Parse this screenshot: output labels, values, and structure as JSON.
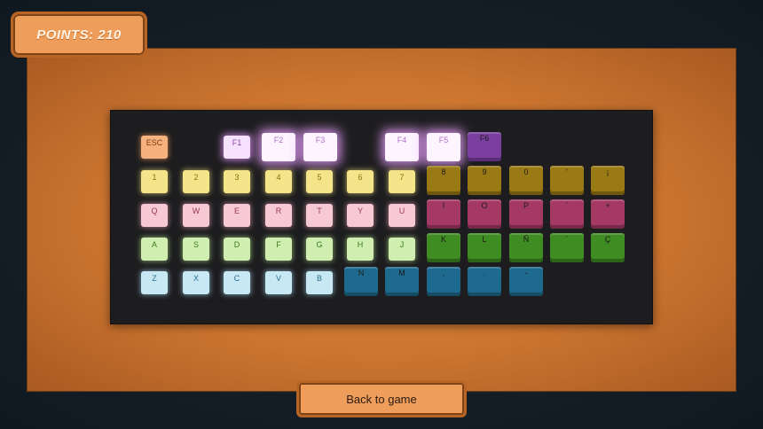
{
  "hud": {
    "points": "POINTS: 210"
  },
  "buttons": {
    "back": "Back to game"
  },
  "keys": {
    "esc": "ESC",
    "f1": "F1",
    "f2": "F2",
    "f3": "F3",
    "f4": "F4",
    "f5": "F5",
    "f6": "F6",
    "n1": "1",
    "n2": "2",
    "n3": "3",
    "n4": "4",
    "n5": "5",
    "n6": "6",
    "n7": "7",
    "n8": "8",
    "n9": "9",
    "n0": "0",
    "apos": "'",
    "iexcl": "¡",
    "q": "Q",
    "w": "W",
    "e": "E",
    "r": "R",
    "t": "T",
    "yk": "Y",
    "u": "U",
    "i": "I",
    "o": "O",
    "pk": "P",
    "grave": "`",
    "plus": "+",
    "a": "A",
    "s": "S",
    "d": "D",
    "f": "F",
    "gk": "G",
    "h": "H",
    "j": "J",
    "k": "K",
    "l": "L",
    "ntilde": "Ñ",
    "acute": "´",
    "ccedil": "Ç",
    "z": "Z",
    "x": "X",
    "c": "C",
    "v": "V",
    "bk": "B",
    "n": "N",
    "m": "M",
    "comma": ",",
    "period": ".",
    "minus": "-"
  },
  "colors": {
    "frame": "#cc7530",
    "board": "#1d1d1f",
    "button_fill": "#ee9d5a",
    "yellow_row": "#f5e58a",
    "pink_row": "#f6c9d4",
    "green_row": "#cfeeb0",
    "blue_row": "#c8e8f4",
    "function_keys": "#f6e1ff"
  }
}
